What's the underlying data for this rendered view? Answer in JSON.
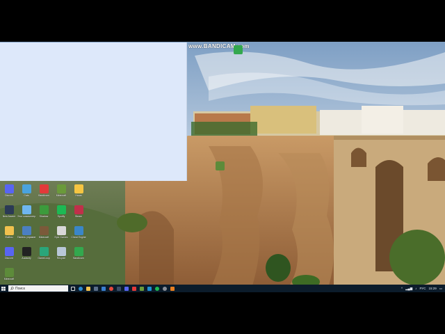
{
  "watermark": {
    "text": "www.BANDICAM.com"
  },
  "desktop": {
    "icons": [
      {
        "label": "Discord",
        "color": "#5865f2"
      },
      {
        "label": "Cats",
        "color": "#4aa3df"
      },
      {
        "label": "Bandicam",
        "color": "#e23a3a"
      },
      {
        "label": "Minecraft",
        "color": "#6a9a3a"
      },
      {
        "label": "Наши",
        "color": "#f5c542"
      },
      {
        "label": "New Ascent",
        "color": "#2b3a55"
      },
      {
        "label": "Этот компьютер",
        "color": "#6fb6f0"
      },
      {
        "label": "Shadow",
        "color": "#3c9b3c"
      },
      {
        "label": "Spotify",
        "color": "#1db954"
      },
      {
        "label": "Steam",
        "color": "#c0304a"
      },
      {
        "label": "Файлы",
        "color": "#f2c14e"
      },
      {
        "label": "Панель управления",
        "color": "#4b7fc1"
      },
      {
        "label": "Minecraft",
        "color": "#7b5a3a"
      },
      {
        "label": "Epic Games",
        "color": "#d8d8d8"
      },
      {
        "label": "Cheat Engine",
        "color": "#3a86c8"
      },
      {
        "label": "Discord",
        "color": "#5865f2"
      },
      {
        "label": "Audacity",
        "color": "#222222"
      },
      {
        "label": "GameLoop",
        "color": "#2aa67a"
      },
      {
        "label": "Recycle",
        "color": "#b8c7d8"
      },
      {
        "label": "Bandicam",
        "color": "#33a84e"
      },
      {
        "label": "Minecraft",
        "color": "#5d8b3a"
      }
    ]
  },
  "taskbar": {
    "search_placeholder": "Поиск",
    "tray": {
      "lang": "РУС",
      "time": "15:29"
    }
  },
  "colors": {
    "taskbar": "#0c1c2b",
    "blank_window": "#dde8fa"
  }
}
